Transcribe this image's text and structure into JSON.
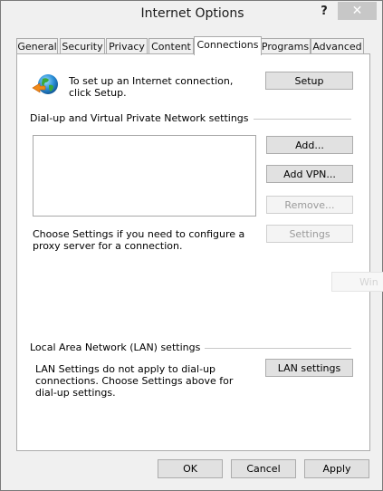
{
  "window": {
    "title": "Internet Options",
    "help_label": "?",
    "close_label": "✕"
  },
  "tabs": [
    {
      "label": "General"
    },
    {
      "label": "Security"
    },
    {
      "label": "Privacy"
    },
    {
      "label": "Content"
    },
    {
      "label": "Connections"
    },
    {
      "label": "Programs"
    },
    {
      "label": "Advanced"
    }
  ],
  "connections": {
    "setup_text": "To set up an Internet connection, click Setup.",
    "setup_button": "Setup",
    "dialup_group_label": "Dial-up and Virtual Private Network settings",
    "add_button": "Add...",
    "add_vpn_button": "Add VPN...",
    "remove_button": "Remove...",
    "proxy_text": "Choose Settings if you need to configure a proxy server for a connection.",
    "settings_button": "Settings",
    "lan_group_label": "Local Area Network (LAN) settings",
    "lan_text": "LAN Settings do not apply to dial-up connections. Choose Settings above for dial-up settings.",
    "lan_settings_button": "LAN settings"
  },
  "footer": {
    "ok_button": "OK",
    "cancel_button": "Cancel",
    "apply_button": "Apply"
  },
  "ghost_text": "Win"
}
